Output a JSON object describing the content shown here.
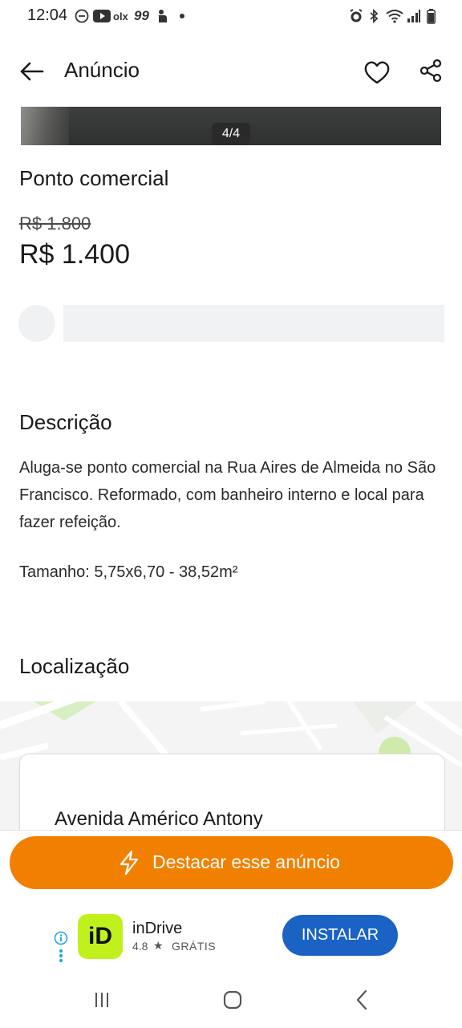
{
  "status_bar": {
    "time": "12:04",
    "notification_icons": [
      "do-not-disturb-icon",
      "youtube-icon",
      "olx-icon",
      "app-99-icon",
      "touch-icon",
      "dot-icon"
    ],
    "system_icons": [
      "alarm-icon",
      "bluetooth-icon",
      "wifi-icon",
      "signal-icon",
      "battery-icon"
    ]
  },
  "header": {
    "title": "Anúncio",
    "icons": [
      "back-arrow-icon",
      "heart-icon",
      "share-icon"
    ]
  },
  "gallery": {
    "counter": "4/4"
  },
  "listing": {
    "title": "Ponto comercial",
    "old_price": "R$ 1.800",
    "price": "R$ 1.400"
  },
  "description": {
    "title": "Descrição",
    "text": "Aluga-se ponto comercial na Rua Aires de Almeida no São Francisco. Reformado, com banheiro interno e local para fazer refeição.",
    "size": "Tamanho: 5,75x6,70 - 38,52m²"
  },
  "location": {
    "title": "Localização",
    "address": "Avenida Américo Antony"
  },
  "actions": {
    "highlight_label": "Destacar esse anúncio",
    "highlight_icon": "lightning-icon"
  },
  "ad": {
    "app_name": "inDrive",
    "rating": "4.8",
    "price_label": "GRÁTIS",
    "install_label": "INSTALAR",
    "app_icon_text": "iD",
    "colors": {
      "app_icon": "#c1f11d",
      "install_button": "#1a62c4"
    }
  },
  "colors": {
    "accent": "#f28000",
    "text": "#1a1a1a"
  }
}
